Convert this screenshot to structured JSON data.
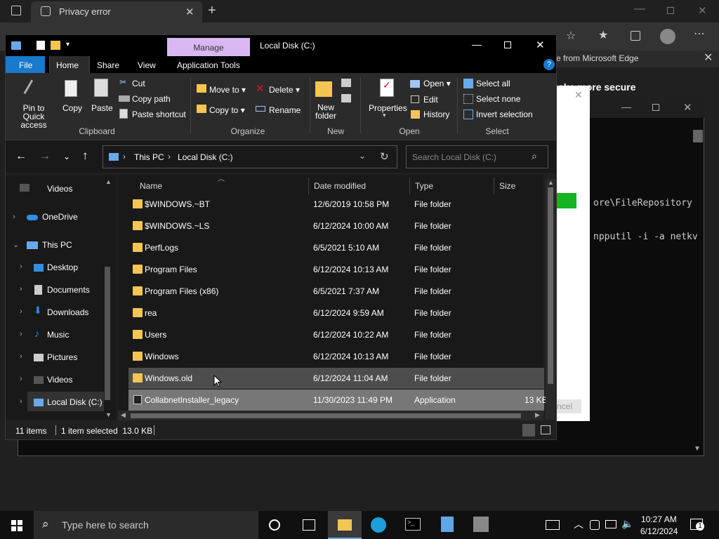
{
  "edge": {
    "tab_title": "Privacy error",
    "info_text": "e from Microsoft Edge",
    "heading": "ake more secure",
    "cancel_label": "ncel"
  },
  "cmd": {
    "line1": "ore\\FileRepository",
    "line2": "npputil -i -a netkv"
  },
  "explorer": {
    "title": "Local Disk (C:)",
    "manage_tab": "Manage",
    "tabs": [
      "File",
      "Home",
      "Share",
      "View",
      "Application Tools"
    ],
    "ribbon": {
      "pin_label": "Pin to Quick access",
      "copy": "Copy",
      "paste": "Paste",
      "cut": "Cut",
      "copy_path": "Copy path",
      "paste_shortcut": "Paste shortcut",
      "clipboard": "Clipboard",
      "move_to": "Move to",
      "copy_to": "Copy to",
      "delete": "Delete",
      "rename": "Rename",
      "organize": "Organize",
      "new_folder": "New folder",
      "new": "New",
      "properties": "Properties",
      "open_btn": "Open",
      "edit": "Edit",
      "history": "History",
      "open_group": "Open",
      "select_all": "Select all",
      "select_none": "Select none",
      "invert_selection": "Invert selection",
      "select_group": "Select"
    },
    "breadcrumb": [
      "This PC",
      "Local Disk (C:)"
    ],
    "search_placeholder": "Search Local Disk (C:)",
    "nav": [
      {
        "label": "Videos"
      },
      {
        "label": "OneDrive"
      },
      {
        "label": "This PC"
      },
      {
        "label": "Desktop"
      },
      {
        "label": "Documents"
      },
      {
        "label": "Downloads"
      },
      {
        "label": "Music"
      },
      {
        "label": "Pictures"
      },
      {
        "label": "Videos"
      },
      {
        "label": "Local Disk (C:)"
      }
    ],
    "columns": [
      "Name",
      "Date modified",
      "Type",
      "Size"
    ],
    "files": [
      {
        "name": "$WINDOWS.~BT",
        "date": "12/6/2019 10:58 PM",
        "type": "File folder",
        "size": ""
      },
      {
        "name": "$WINDOWS.~LS",
        "date": "6/12/2024 10:00 AM",
        "type": "File folder",
        "size": ""
      },
      {
        "name": "PerfLogs",
        "date": "6/5/2021 5:10 AM",
        "type": "File folder",
        "size": ""
      },
      {
        "name": "Program Files",
        "date": "6/12/2024 10:13 AM",
        "type": "File folder",
        "size": ""
      },
      {
        "name": "Program Files (x86)",
        "date": "6/5/2021 7:37 AM",
        "type": "File folder",
        "size": ""
      },
      {
        "name": "rea",
        "date": "6/12/2024 9:59 AM",
        "type": "File folder",
        "size": ""
      },
      {
        "name": "Users",
        "date": "6/12/2024 10:22 AM",
        "type": "File folder",
        "size": ""
      },
      {
        "name": "Windows",
        "date": "6/12/2024 10:13 AM",
        "type": "File folder",
        "size": ""
      },
      {
        "name": "Windows.old",
        "date": "6/12/2024 11:04 AM",
        "type": "File folder",
        "size": ""
      },
      {
        "name": "CollabnetInstaller_legacy",
        "date": "11/30/2023 11:49 PM",
        "type": "Application",
        "size": "13 KB"
      }
    ],
    "status": {
      "items": "11 items",
      "selected": "1 item selected  13.0 KB"
    }
  },
  "taskbar": {
    "search_placeholder": "Type here to search",
    "time": "10:27 AM",
    "date": "6/12/2024",
    "notification_count": "1"
  }
}
